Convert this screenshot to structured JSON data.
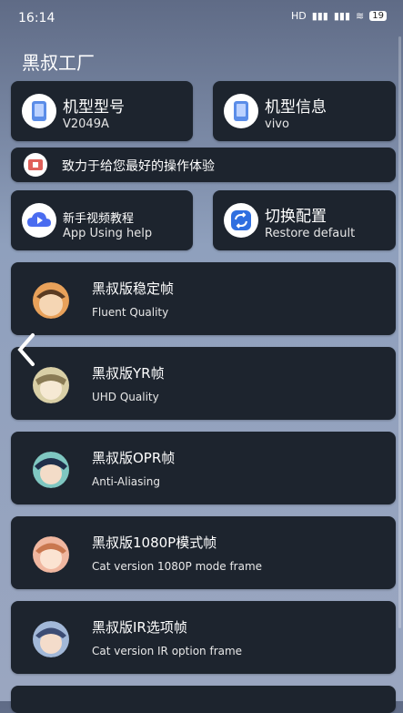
{
  "status": {
    "time": "16:14",
    "battery": "19"
  },
  "app": {
    "title": "黑叔工厂"
  },
  "info_cards": [
    {
      "title": "机型型号",
      "sub": "V2049A",
      "icon": "phone-icon"
    },
    {
      "title": "机型信息",
      "sub": "vivo",
      "icon": "phone-icon"
    }
  ],
  "banner": {
    "text": "致力于给您最好的操作体验",
    "icon": "gift-icon"
  },
  "action_cards": [
    {
      "title": "新手视频教程",
      "sub": "App Using help",
      "icon": "cloud-play-icon"
    },
    {
      "title": "切换配置",
      "sub": "Restore default",
      "icon": "refresh-icon"
    }
  ],
  "modes": [
    {
      "title": "黑叔版稳定帧",
      "sub": "Fluent Quality"
    },
    {
      "title": "黑叔版YR帧",
      "sub": " UHD Quality"
    },
    {
      "title": "黑叔版OPR帧",
      "sub": "Anti-Aliasing"
    },
    {
      "title": "黑叔版1080P模式帧",
      "sub": "Cat version 1080P mode frame"
    },
    {
      "title": "黑叔版IR选项帧",
      "sub": "Cat version IR option frame"
    }
  ]
}
